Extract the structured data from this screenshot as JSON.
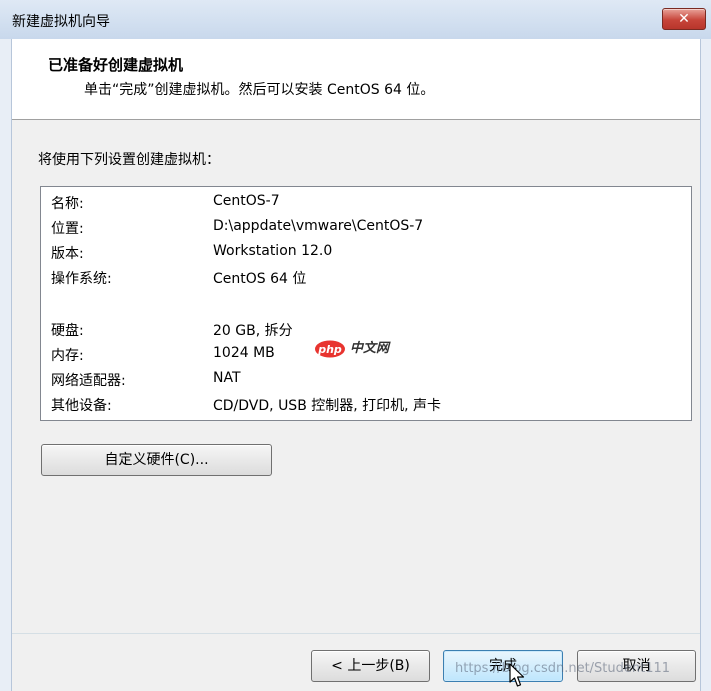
{
  "window": {
    "title": "新建虚拟机向导",
    "close_glyph": "✕"
  },
  "header": {
    "title": "已准备好创建虚拟机",
    "subtitle": "单击“完成”创建虚拟机。然后可以安装 CentOS 64 位。"
  },
  "intro": "将使用下列设置创建虚拟机：",
  "summary": [
    {
      "key": "名称:",
      "value": "CentOS-7"
    },
    {
      "key": "位置:",
      "value": "D:\\appdate\\vmware\\CentOS-7"
    },
    {
      "key": "版本:",
      "value": "Workstation 12.0"
    },
    {
      "key": "操作系统:",
      "value": "CentOS 64 位"
    },
    {
      "key": "硬盘:",
      "value": "20 GB, 拆分"
    },
    {
      "key": "内存:",
      "value": "1024 MB"
    },
    {
      "key": "网络适配器:",
      "value": "NAT"
    },
    {
      "key": "其他设备:",
      "value": "CD/DVD, USB 控制器, 打印机, 声卡"
    }
  ],
  "buttons": {
    "customize": "自定义硬件(C)...",
    "back": "< 上一步(B)",
    "finish": "完成",
    "cancel": "取消"
  },
  "watermark": {
    "logo_text": "php",
    "site_text": "中文网",
    "url": "https://blog.csdn.net/Student111"
  },
  "colors": {
    "accent": "#3c7fb1",
    "close_button": "#c7453a"
  }
}
